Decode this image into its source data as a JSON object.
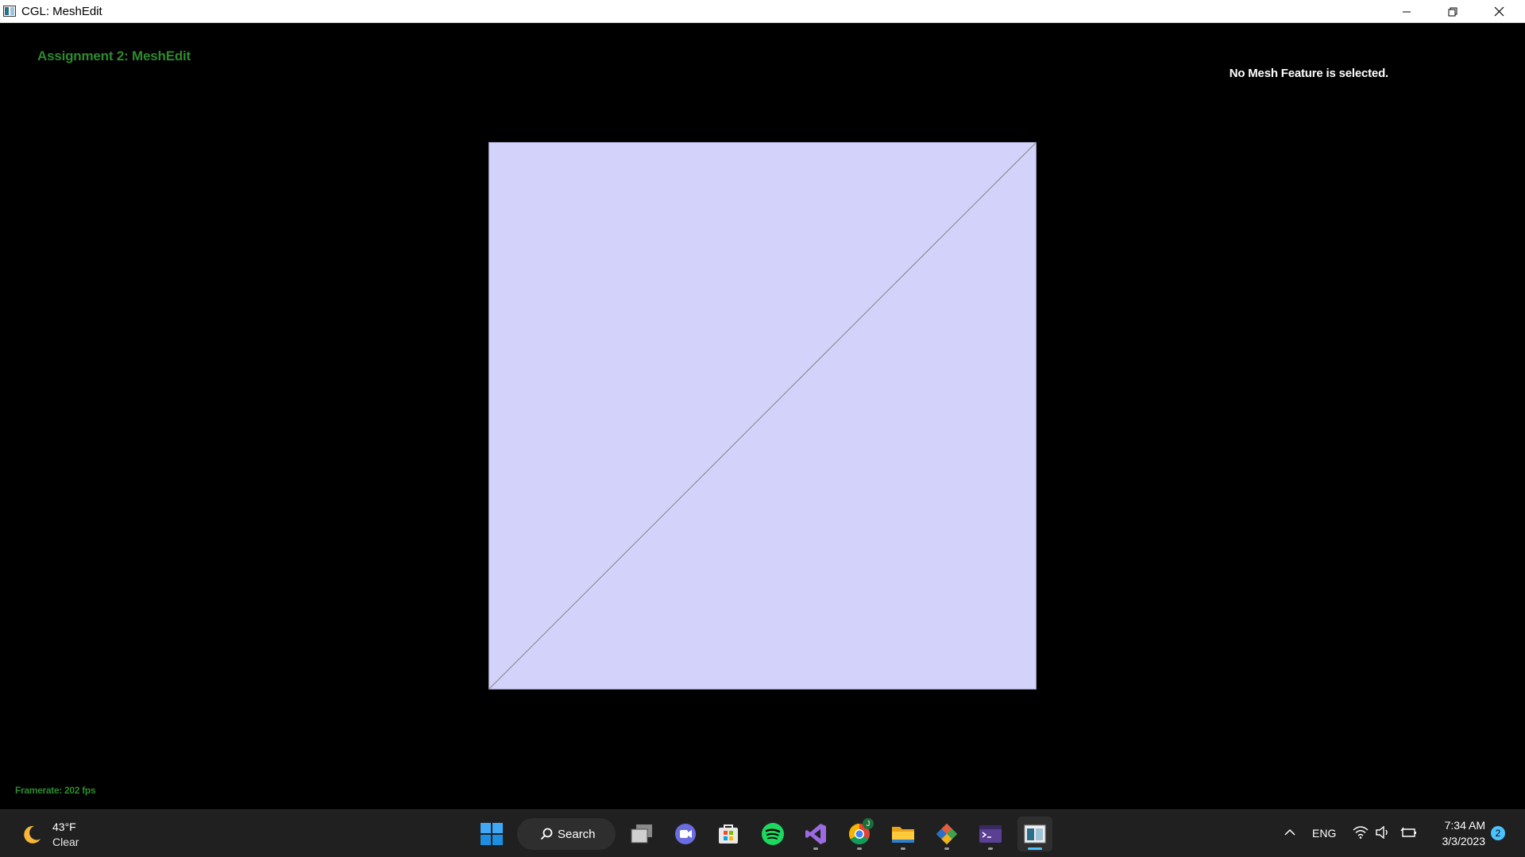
{
  "window": {
    "title": "CGL: MeshEdit",
    "controls": [
      "minimize-icon",
      "restore-icon",
      "close-icon"
    ]
  },
  "viewport": {
    "assignment_title": "Assignment 2: MeshEdit",
    "selection_status": "No Mesh Feature is selected.",
    "framerate": "Framerate: 202 fps",
    "mesh": {
      "face_color": "#d2d2fb",
      "edge_color": "#888888",
      "background_color": "#000000",
      "text_accent": "#2d8a2d"
    }
  },
  "taskbar": {
    "weather": {
      "temp": "43°F",
      "condition": "Clear",
      "icon": "moon-icon"
    },
    "search_label": "Search",
    "apps": [
      {
        "name": "start",
        "icon": "windows-logo-icon"
      },
      {
        "name": "task-view",
        "icon": "task-view-icon"
      },
      {
        "name": "chat",
        "icon": "chat-icon"
      },
      {
        "name": "store",
        "icon": "store-icon"
      },
      {
        "name": "spotify",
        "icon": "spotify-icon"
      },
      {
        "name": "visual-studio",
        "icon": "visual-studio-icon"
      },
      {
        "name": "chrome",
        "icon": "chrome-icon",
        "badge": "J"
      },
      {
        "name": "file-explorer",
        "icon": "folder-icon"
      },
      {
        "name": "git-tool",
        "icon": "git-icon"
      },
      {
        "name": "terminal",
        "icon": "terminal-icon"
      },
      {
        "name": "meshedit",
        "icon": "meshedit-app-icon"
      }
    ],
    "tray": {
      "language": "ENG",
      "time": "7:34 AM",
      "date": "3/3/2023",
      "notifications": "2"
    }
  }
}
